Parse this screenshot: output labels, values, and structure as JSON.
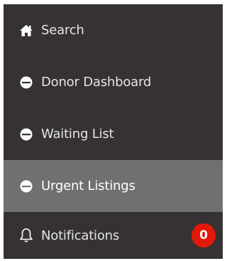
{
  "nav": {
    "items": [
      {
        "label": "Search",
        "icon": "home-icon"
      },
      {
        "label": "Donor Dashboard",
        "icon": "half-circle-icon"
      },
      {
        "label": "Waiting List",
        "icon": "half-circle-icon"
      },
      {
        "label": "Urgent Listings",
        "icon": "half-circle-icon",
        "active": true
      },
      {
        "label": "Notifications",
        "icon": "bell-icon",
        "badge": "0"
      }
    ]
  },
  "colors": {
    "sidebar_bg": "#363233",
    "active_bg": "#707070",
    "badge_bg": "#e3170a",
    "text": "#e4e4e4"
  }
}
